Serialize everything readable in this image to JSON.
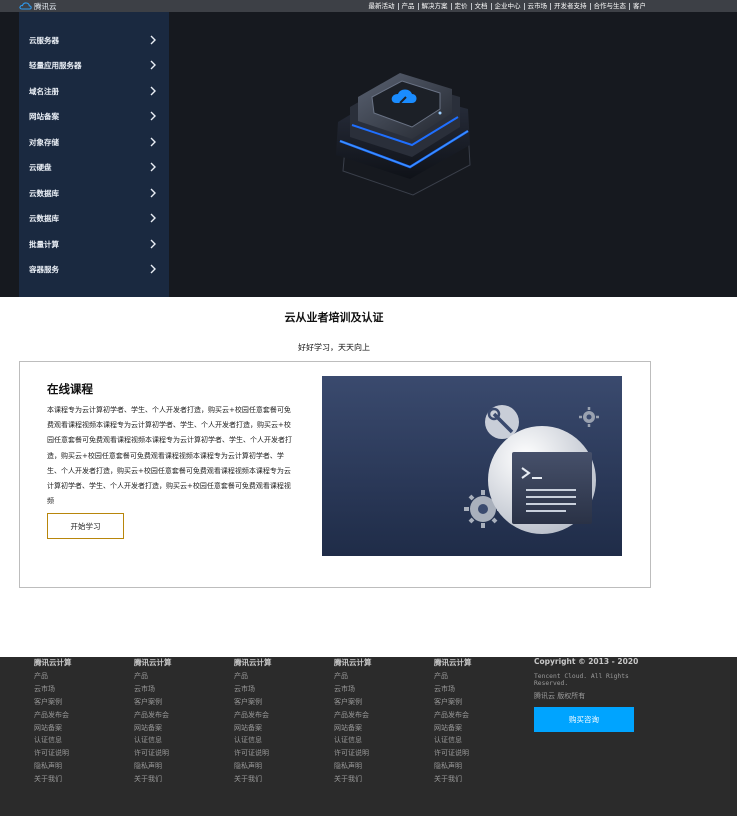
{
  "header": {
    "logo_text": "腾讯云",
    "nav": [
      "最新活动",
      "产品",
      "解决方案",
      "定价",
      "文档",
      "企业中心",
      "云市场",
      "开发者支持",
      "合作与生态",
      "客户"
    ]
  },
  "sidebar": {
    "items": [
      {
        "label": "云服务器"
      },
      {
        "label": "轻量应用服务器"
      },
      {
        "label": "域名注册"
      },
      {
        "label": "网站备案"
      },
      {
        "label": "对象存储"
      },
      {
        "label": "云硬盘"
      },
      {
        "label": "云数据库"
      },
      {
        "label": "云数据库"
      },
      {
        "label": "批量计算"
      },
      {
        "label": "容器服务"
      }
    ]
  },
  "section": {
    "title": "云从业者培训及认证",
    "subtitle": "好好学习，天天向上"
  },
  "course": {
    "title": "在线课程",
    "description": "本课程专为云计算初学者、学生、个人开发者打造，购买云+校园任意套餐可免费观看课程视频本课程专为云计算初学者、学生、个人开发者打造，购买云+校园任意套餐可免费观看课程视频本课程专为云计算初学者、学生、个人开发者打造，购买云+校园任意套餐可免费观看课程视频本课程专为云计算初学者、学生、个人开发者打造，购买云+校园任意套餐可免费观看课程视频本课程专为云计算初学者、学生、个人开发者打造，购买云+校园任意套餐可免费观看课程视频",
    "button": "开始学习"
  },
  "footer": {
    "columns": [
      {
        "title": "腾讯云计算",
        "links": [
          "产品",
          "云市场",
          "客户案例",
          "产品发布会",
          "网站备案",
          "认证信息",
          "许可证说明",
          "隐私声明",
          "关于我们"
        ]
      },
      {
        "title": "腾讯云计算",
        "links": [
          "产品",
          "云市场",
          "客户案例",
          "产品发布会",
          "网站备案",
          "认证信息",
          "许可证说明",
          "隐私声明",
          "关于我们"
        ]
      },
      {
        "title": "腾讯云计算",
        "links": [
          "产品",
          "云市场",
          "客户案例",
          "产品发布会",
          "网站备案",
          "认证信息",
          "许可证说明",
          "隐私声明",
          "关于我们"
        ]
      },
      {
        "title": "腾讯云计算",
        "links": [
          "产品",
          "云市场",
          "客户案例",
          "产品发布会",
          "网站备案",
          "认证信息",
          "许可证说明",
          "隐私声明",
          "关于我们"
        ]
      },
      {
        "title": "腾讯云计算",
        "links": [
          "产品",
          "云市场",
          "客户案例",
          "产品发布会",
          "网站备案",
          "认证信息",
          "许可证说明",
          "隐私声明",
          "关于我们"
        ]
      }
    ],
    "copyright": "Copyright © 2013 - 2020",
    "company": "Tencent Cloud. All Rights Reserved.",
    "rights": "腾讯云 版权所有",
    "buy_button": "购买咨询"
  },
  "colors": {
    "topbar": "#3d4046",
    "hero_bg": "#16191f",
    "sidebar_bg": "#1a2940",
    "accent_blue": "#00a4ff",
    "button_border": "#b8860b",
    "footer_bg": "#2b2b2b"
  }
}
